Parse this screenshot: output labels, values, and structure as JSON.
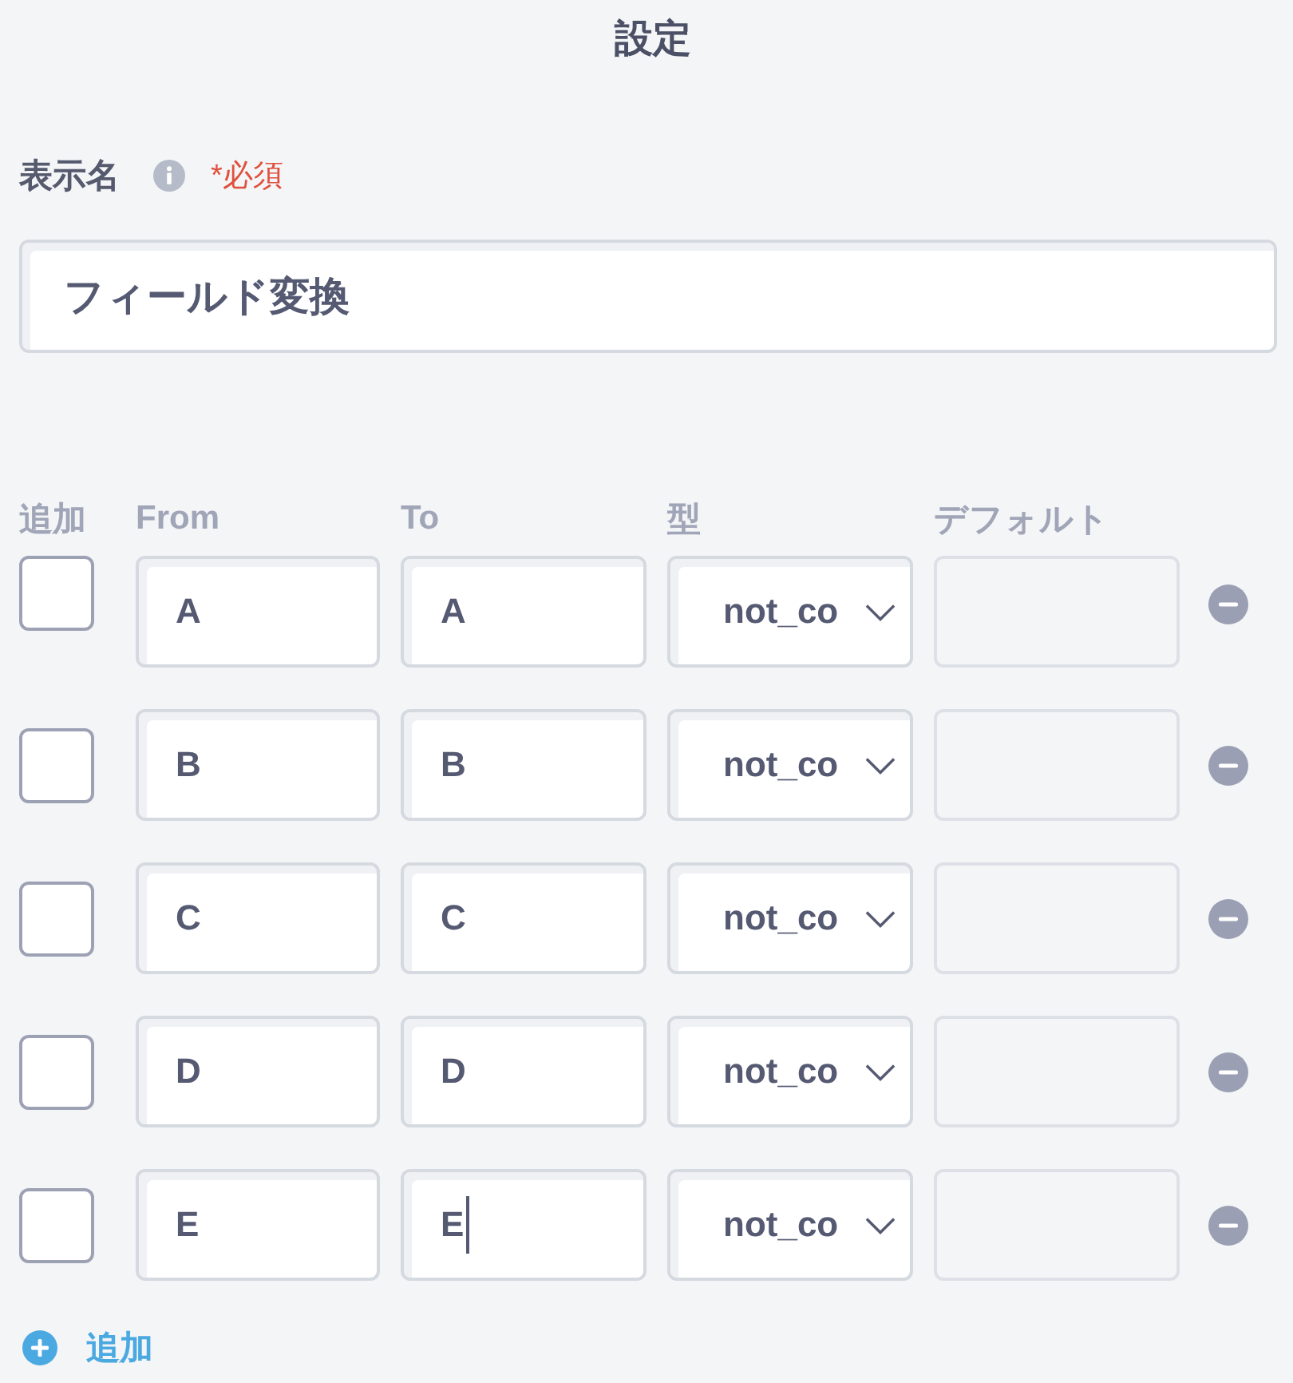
{
  "title": "設定",
  "display_name": {
    "label": "表示名",
    "required_mark": "*必須",
    "value": "フィールド変換"
  },
  "columns": [
    "追加",
    "From",
    "To",
    "型",
    "デフォルト"
  ],
  "rows": [
    {
      "checked": false,
      "from": "A",
      "to": "A",
      "type": "not_co",
      "to_focused": false
    },
    {
      "checked": false,
      "from": "B",
      "to": "B",
      "type": "not_co",
      "to_focused": false
    },
    {
      "checked": false,
      "from": "C",
      "to": "C",
      "type": "not_co",
      "to_focused": false
    },
    {
      "checked": false,
      "from": "D",
      "to": "D",
      "type": "not_co",
      "to_focused": false
    },
    {
      "checked": false,
      "from": "E",
      "to": "E",
      "type": "not_co",
      "to_focused": true
    }
  ],
  "add_button": {
    "label": "追加"
  }
}
